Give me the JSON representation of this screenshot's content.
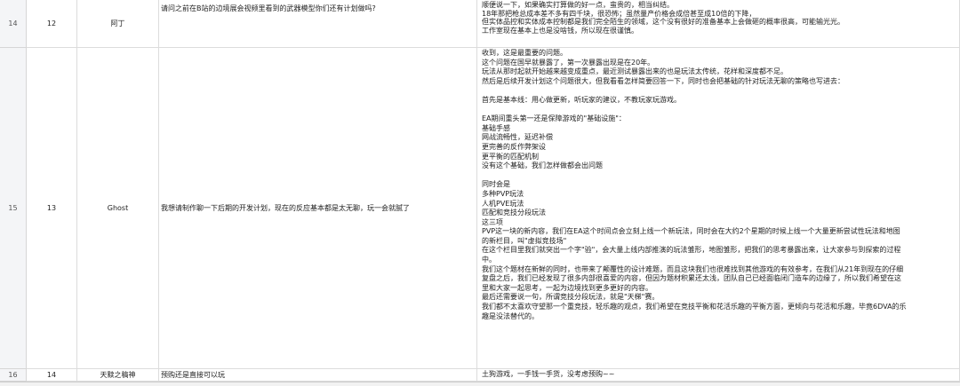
{
  "rows": [
    {
      "row_number": "14",
      "no": "12",
      "name": "阿丁",
      "question": "请问之前在B站的边境展会视频里看到的武器模型你们还有计划做吗?",
      "answer_lines": [
        "顺便说一下，如果确实打算做的好一点，蛮贵的，相当纠结。",
        "18年那把枪总成本差不多有四千块，很恐怖；虽然量产价格会成倍甚至成10倍的下降，",
        "但实体品控和实体成本控制都是我们完全陌生的领域，这个没有很好的准备基本上会做砸的概率很高，可能输光光。",
        "工作室现在基本上也是没啥钱，所以现在很谨慎。"
      ]
    },
    {
      "row_number": "15",
      "no": "13",
      "name": "Ghost",
      "question": "我想请制作聊一下后期的开发计划，现在的反应基本都是太无聊，玩一会就腻了",
      "answer_lines": [
        "收到，这是最重要的问题。",
        "这个问题在国早就暴露了，第一次暴露出现是在20年。",
        "玩法从那时起就开始越来越变成重点，最近测试暴露出来的也是玩法太传统，花样和深度都不足。",
        "然后是后续开发计划这个问题很大，但我看看怎样简要回答一下，同时也会把基础的针对玩法无聊的策略也写进去：",
        "",
        "首先是基本线：用心做更新，听玩家的建议，不教玩家玩游戏。",
        "",
        "EA期间重头第一还是保障游戏的\"基础设施\"：",
        "基础手感",
        "网战流畅性，延迟补偿",
        "更完善的反作弊架设",
        "更平衡的匹配机制",
        "没有这个基础，我们怎样做都会出问题",
        "",
        "同时会是",
        "多种PVP玩法",
        "人机PVE玩法",
        "匹配和竞技分段玩法",
        "这三项",
        "PVP这一块的新内容，我们在EA这个时间点会立刻上线一个新玩法，同时会在大约2个星期的时候上线一个大量更新尝试性玩法和地图",
        "的新栏目，叫\"虚拟竞技场\"",
        "在这个栏目里我们就突出一个字\"验\"，会大量上线内部推演的玩法雏形，地图雏形，把我们的思考暴露出来，让大家参与到探索的过程",
        "中。",
        "我们这个题材在新鲜的同时，也带来了颠覆性的设计难题，而且这块我们也很难找到其他游戏的有效参考，在我们从21年到现在的仔细",
        "复盘之后，我们已经发现了很多内部很喜爱的内容，但因为题材积累还太浅，团队自己已经面临闭门造车的边缘了，所以我们希望在这",
        "里和大家一起思考，一起为边境找到更多更好的内容。",
        "最后还需要说一句，所谓竞技分段玩法，就是\"天梯\"赛。",
        "我们都不太喜欢守望那一个重竞技，轻乐趣的观点，我们希望在竞技平衡和花活乐趣的平衡方面，更倾向与花活和乐趣，毕竟6DVA的乐",
        "趣是没法替代的。"
      ]
    },
    {
      "row_number": "16",
      "no": "14",
      "name": "天黩之稿神",
      "question": "预购还是直接可以玩",
      "answer_lines": [
        "土狗游戏，一手钱一手货，没考虑预购~~"
      ]
    }
  ]
}
